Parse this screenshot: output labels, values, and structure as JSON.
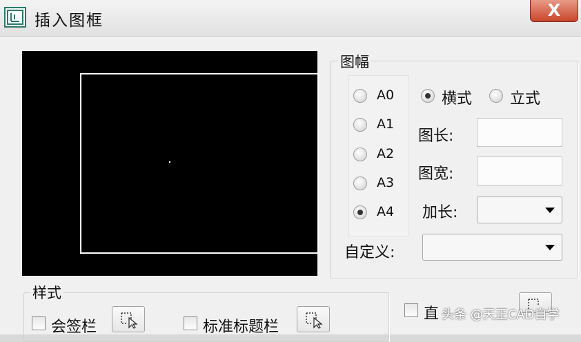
{
  "window": {
    "title": "插入图框",
    "close_label": "X"
  },
  "paper_group": {
    "label": "图幅",
    "sizes": [
      {
        "label": "A0",
        "selected": false
      },
      {
        "label": "A1",
        "selected": false
      },
      {
        "label": "A2",
        "selected": false
      },
      {
        "label": "A3",
        "selected": false
      },
      {
        "label": "A4",
        "selected": true
      }
    ],
    "orientation": [
      {
        "label": "横式",
        "selected": true
      },
      {
        "label": "立式",
        "selected": false
      }
    ],
    "length_label": "图长:",
    "length_value": "",
    "width_label": "图宽:",
    "width_value": "",
    "extend_label": "加长:",
    "extend_value": "",
    "custom_label": "自定义:",
    "custom_value": ""
  },
  "style_group": {
    "label": "样式",
    "countersign_label": "会签栏",
    "standard_title_label": "标准标题栏",
    "direct_label": "直"
  },
  "watermark": "头条 @天正CAD自学",
  "colors": {
    "preview_bg": "#000000",
    "preview_frame": "#ffffff",
    "close_button": "#c9452b"
  }
}
